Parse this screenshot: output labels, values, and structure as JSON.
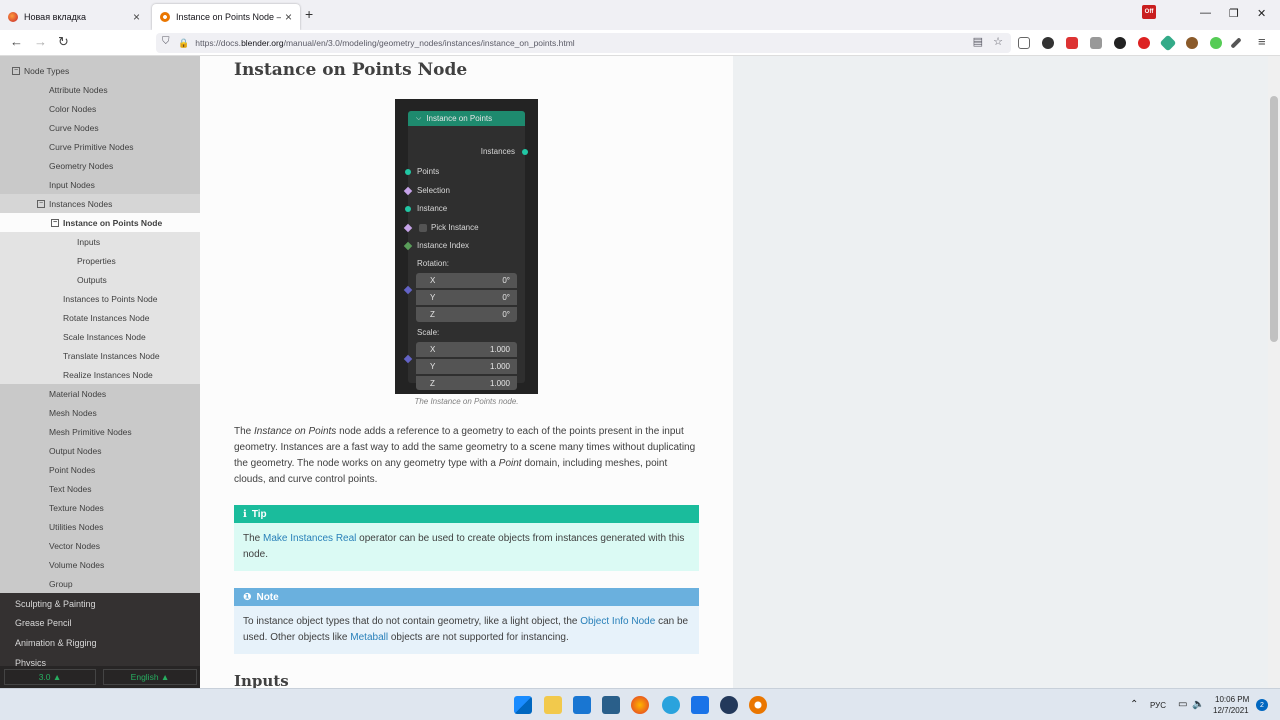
{
  "browser": {
    "tabs": [
      {
        "title": "Новая вкладка",
        "active": false
      },
      {
        "title": "Instance on Points Node — Ble",
        "active": true
      }
    ],
    "new_tab_icon": "+",
    "url_prefix": "https://docs.",
    "url_host": "blender.org",
    "url_path": "/manual/en/3.0/modeling/geometry_nodes/instances/instance_on_points.html",
    "badge": "Off"
  },
  "sidebar": {
    "items": [
      {
        "label": "Node Types",
        "level": 1,
        "toggle": "⊟"
      },
      {
        "label": "Attribute Nodes",
        "level": 2
      },
      {
        "label": "Color Nodes",
        "level": 2
      },
      {
        "label": "Curve Nodes",
        "level": 2
      },
      {
        "label": "Curve Primitive Nodes",
        "level": 2
      },
      {
        "label": "Geometry Nodes",
        "level": 2
      },
      {
        "label": "Input Nodes",
        "level": 2
      },
      {
        "label": "Instances Nodes",
        "level": 2,
        "toggle": "⊟"
      },
      {
        "label": "Instance on Points Node",
        "level": 3,
        "toggle": "⊟",
        "current": true
      },
      {
        "label": "Inputs",
        "level": 4
      },
      {
        "label": "Properties",
        "level": 4
      },
      {
        "label": "Outputs",
        "level": 4
      },
      {
        "label": "Instances to Points Node",
        "level": 3
      },
      {
        "label": "Rotate Instances Node",
        "level": 3
      },
      {
        "label": "Scale Instances Node",
        "level": 3
      },
      {
        "label": "Translate Instances Node",
        "level": 3
      },
      {
        "label": "Realize Instances Node",
        "level": 3
      },
      {
        "label": "Material Nodes",
        "level": 2
      },
      {
        "label": "Mesh Nodes",
        "level": 2
      },
      {
        "label": "Mesh Primitive Nodes",
        "level": 2
      },
      {
        "label": "Output Nodes",
        "level": 2
      },
      {
        "label": "Point Nodes",
        "level": 2
      },
      {
        "label": "Text Nodes",
        "level": 2
      },
      {
        "label": "Texture Nodes",
        "level": 2
      },
      {
        "label": "Utilities Nodes",
        "level": 2
      },
      {
        "label": "Vector Nodes",
        "level": 2
      },
      {
        "label": "Volume Nodes",
        "level": 2
      },
      {
        "label": "Group",
        "level": 2
      },
      {
        "label": "Sculpting & Painting",
        "level": 0
      },
      {
        "label": "Grease Pencil",
        "level": 0
      },
      {
        "label": "Animation & Rigging",
        "level": 0
      },
      {
        "label": "Physics",
        "level": 0
      }
    ],
    "version_label": "3.0 ▲",
    "language_label": "English ▲"
  },
  "page": {
    "title": "Instance on Points Node",
    "node": {
      "header": "Instance on Points",
      "output": "Instances",
      "inputs": [
        "Points",
        "Selection",
        "Instance",
        "Pick Instance",
        "Instance Index"
      ],
      "rotation_label": "Rotation:",
      "rotation": [
        {
          "axis": "X",
          "value": "0°"
        },
        {
          "axis": "Y",
          "value": "0°"
        },
        {
          "axis": "Z",
          "value": "0°"
        }
      ],
      "scale_label": "Scale:",
      "scale": [
        {
          "axis": "X",
          "value": "1.000"
        },
        {
          "axis": "Y",
          "value": "1.000"
        },
        {
          "axis": "Z",
          "value": "1.000"
        }
      ]
    },
    "caption": "The Instance on Points node.",
    "intro": {
      "p1": "The ",
      "p1_em": "Instance on Points",
      "p2": " node adds a reference to a geometry to each of the points present in the input geometry. Instances are a fast way to add the same geometry to a scene many times without duplicating the geometry. The node works on any geometry type with a ",
      "p2_em": "Point",
      "p3": " domain, including meshes, point clouds, and curve control points."
    },
    "tip": {
      "title": "Tip",
      "pre": "The ",
      "link": "Make Instances Real",
      "post": " operator can be used to create objects from instances generated with this node."
    },
    "note": {
      "title": "Note",
      "pre": "To instance object types that do not contain geometry, like a light object, the ",
      "link1": "Object Info Node",
      "mid": " can be used. Other objects like ",
      "link2": "Metaball",
      "post": " objects are not supported for instancing."
    },
    "section_heading": "Inputs"
  },
  "taskbar": {
    "lang": "РУС",
    "time": "10:06 PM",
    "date": "12/7/2021",
    "notifications": "2"
  },
  "colors": {
    "sidebar_dark": "#343131",
    "node_header": "#1e8a6e",
    "tip_title": "#1abc9c",
    "note_title": "#6ab0de",
    "link": "#2980b9"
  }
}
